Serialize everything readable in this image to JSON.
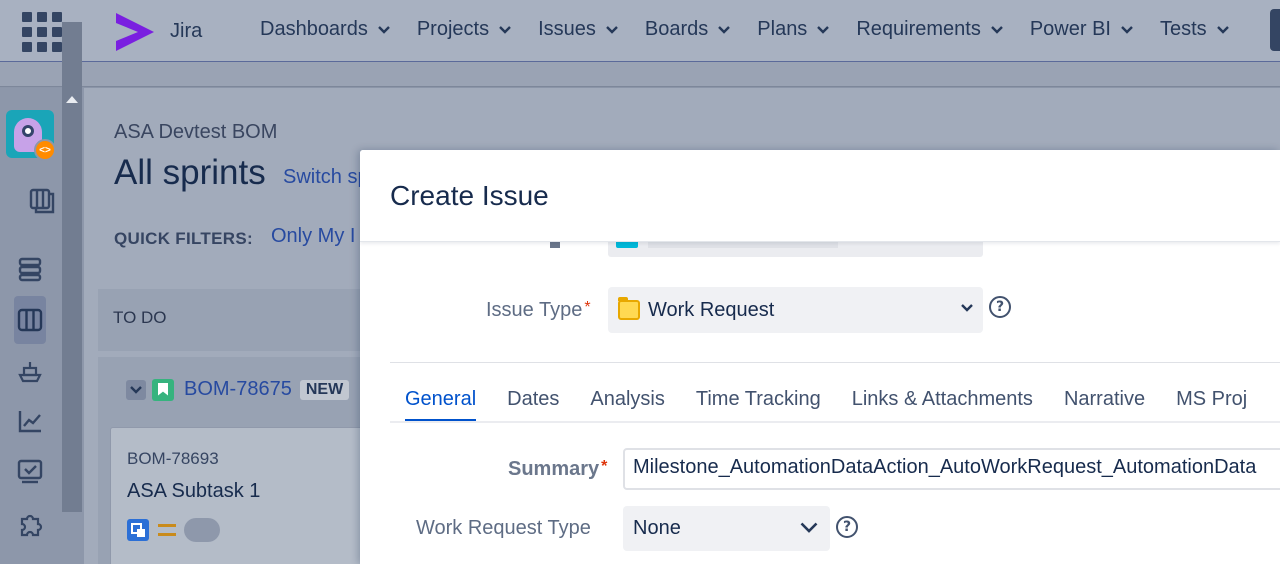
{
  "topnav": {
    "app_name": "Jira",
    "menu": [
      {
        "label": "Dashboards"
      },
      {
        "label": "Projects"
      },
      {
        "label": "Issues"
      },
      {
        "label": "Boards"
      },
      {
        "label": "Plans"
      },
      {
        "label": "Requirements"
      },
      {
        "label": "Power BI"
      },
      {
        "label": "Tests"
      }
    ]
  },
  "sidebar": {
    "icons": [
      "project-avatar",
      "backlog-icon",
      "roadmap-icon",
      "board-icon",
      "releases-icon",
      "reports-icon",
      "tests-icon",
      "addons-icon"
    ],
    "project_badge": "<>"
  },
  "board": {
    "project_name": "ASA Devtest BOM",
    "title": "All sprints",
    "switch_link": "Switch sp",
    "quick_filters_label": "QUICK FILTERS:",
    "quick_filter_only": "Only My I",
    "column_header": "TO DO",
    "parent_key": "BOM-78675",
    "parent_badge": "NEW",
    "card": {
      "key": "BOM-78693",
      "title": "ASA Subtask 1"
    }
  },
  "dialog": {
    "title": "Create Issue",
    "issue_type_label": "Issue Type",
    "issue_type_value": "Work Request",
    "help_symbol": "?",
    "tabs": [
      {
        "label": "General",
        "active": true
      },
      {
        "label": "Dates"
      },
      {
        "label": "Analysis"
      },
      {
        "label": "Time Tracking"
      },
      {
        "label": "Links & Attachments"
      },
      {
        "label": "Narrative"
      },
      {
        "label": "MS Proj"
      }
    ],
    "summary_label": "Summary",
    "summary_value": "Milestone_AutomationDataAction_AutoWorkRequest_AutomationData",
    "wrt_label": "Work Request Type",
    "wrt_value": "None",
    "required_marker": "*"
  },
  "colors": {
    "accent": "#0052cc",
    "required": "#de350b",
    "brand": "#6a0dcf"
  }
}
